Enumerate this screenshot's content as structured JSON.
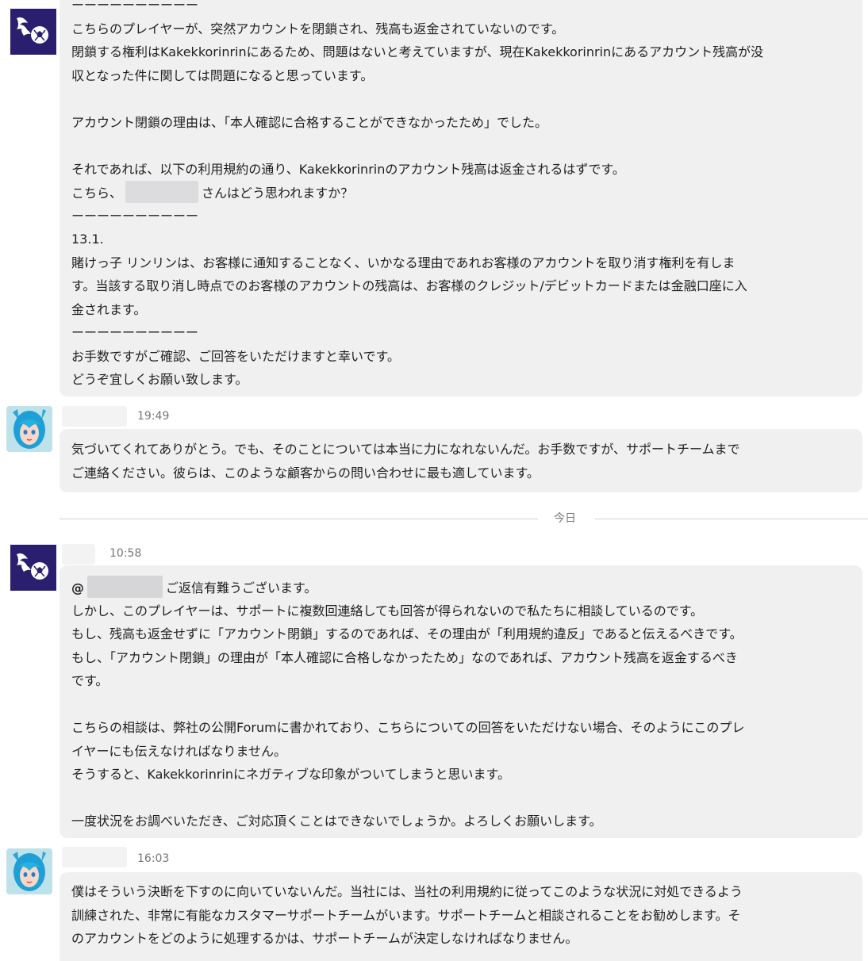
{
  "messages": [
    {
      "lines": [
        "ーーーーーーーーーー",
        "こちらのプレイヤーが、突然アカウントを閉鎖され、残高も返金されていないのです。",
        "閉鎖する権利はKakekkorinrinにあるため、問題はないと考えていますが、現在Kakekkorinrinにあるアカウント残高が没",
        "収となった件に関しては問題になると思っています。",
        "",
        "アカウント閉鎖の理由は、「本人確認に合格することができなかったため」でした。",
        "",
        "それであれば、以下の利用規約の通り、Kakekkorinrinのアカウント残高は返金されるはずです。"
      ],
      "line_with_blur_prefix": "こちら、",
      "line_with_blur_suffix": "さんはどう思われますか？",
      "lines_after": [
        "ーーーーーーーーーー",
        "13.1.",
        "賭けっ子 リンリンは、お客様に通知することなく、いかなる理由であれお客様のアカウントを取り消す権利を有しま",
        "す。当該する取り消し時点でのお客様のアカウントの残高は、お客様のクレジット/デビットカードまたは金融口座に入",
        "金されます。",
        "ーーーーーーーーーー",
        "お手数ですがご確認、ご回答をいただけますと幸いです。",
        "どうぞ宜しくお願い致します。"
      ]
    },
    {
      "time": "19:49",
      "lines": [
        "気づいてくれてありがとう。でも、そのことについては本当に力になれないんだ。お手数ですが、サポートチームまで",
        "ご連絡ください。彼らは、このような顧客からの問い合わせに最も適しています。"
      ]
    },
    {
      "time": "10:58",
      "mention_prefix": "@",
      "mention_suffix": "ご返信有難うございます。",
      "lines": [
        "しかし、このプレイヤーは、サポートに複数回連絡しても回答が得られないので私たちに相談しているのです。",
        "もし、残高も返金せずに「アカウント閉鎖」するのであれば、その理由が「利用規約違反」であると伝えるべきです。",
        "もし、「アカウント閉鎖」の理由が「本人確認に合格しなかったため」なのであれば、アカウント残高を返金するべき",
        "です。",
        "",
        "こちらの相談は、弊社の公開Forumに書かれており、こちらについての回答をいただけない場合、そのようにこのプレ",
        "イヤーにも伝えなければなりません。",
        "そうすると、Kakekkorinrinにネガティブな印象がついてしまうと思います。",
        "",
        "一度状況をお調べいただき、ご対応頂くことはできないでしょうか。よろしくお願いします。"
      ]
    },
    {
      "time": "16:03",
      "lines": [
        "僕はそういう決断を下すのに向いていないんだ。当社には、当社の利用規約に従ってこのような状況に対処できるよう",
        "訓練された、非常に有能なカスタマーサポートチームがいます。サポートチームと相談されることをお勧めします。そ",
        "のアカウントをどのように処理するかは、サポートチームが決定しなければなりません。"
      ]
    }
  ],
  "divider": {
    "label": "今日"
  },
  "colors": {
    "bubble": "#f0f0f1",
    "avatar_bg": "#2a1f6e",
    "timestamp": "#777777"
  },
  "icons": [
    "fire-soccer-ball-icon",
    "anime-girl-avatar"
  ]
}
